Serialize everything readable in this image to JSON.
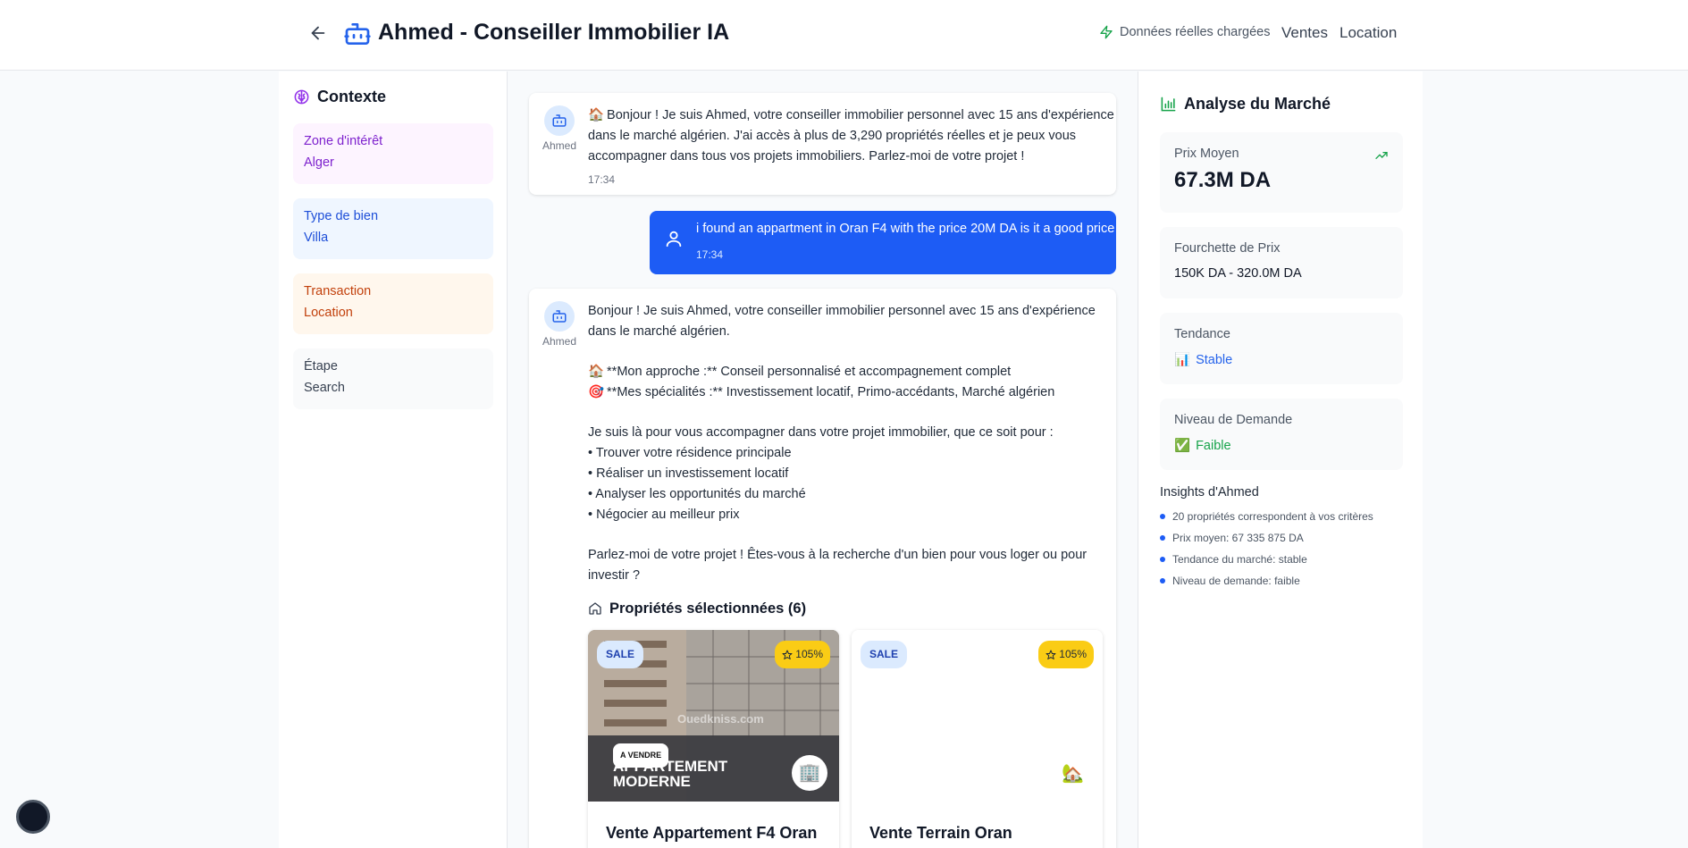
{
  "header": {
    "title": "Ahmed - Conseiller Immobilier IA",
    "status": "Données réelles chargées",
    "nav": [
      "Ventes",
      "Location"
    ]
  },
  "context": {
    "title": "Contexte",
    "cards": [
      {
        "label": "Zone d'intérêt",
        "value": "Alger",
        "bg": "#fdf4ff",
        "color": "#7e22ce"
      },
      {
        "label": "Type de bien",
        "value": "Villa",
        "bg": "#eff6ff",
        "color": "#1d4ed8"
      },
      {
        "label": "Transaction",
        "value": "Location",
        "bg": "#fff7ed",
        "color": "#c2410c"
      },
      {
        "label": "Étape",
        "value": "Search",
        "bg": "#f9fafb",
        "color": "#374151"
      }
    ]
  },
  "chat": {
    "bot_name": "Ahmed",
    "msg1": {
      "emoji": "🏠",
      "text_l1": "Bonjour ! Je suis Ahmed, votre conseiller immobilier personnel avec 15 ans d'expérience",
      "text_l2": "dans le marché algérien. J'ai accès à plus de 3,290 propriétés réelles et je peux vous",
      "text_l3": "accompagner dans tous vos projets immobiliers. Parlez-moi de votre projet !",
      "time": "17:34"
    },
    "user_msg": {
      "text": "i found an appartment in Oran F4 with the price 20M DA is it a good price",
      "time": "17:34"
    },
    "msg2": {
      "l1": "Bonjour ! Je suis Ahmed, votre conseiller immobilier personnel avec 15 ans d'expérience",
      "l2": "dans le marché algérien.",
      "approach_emoji": "🏠",
      "approach": "**Mon approche :** Conseil personnalisé et accompagnement complet",
      "spec_emoji": "🎯",
      "specialties": "**Mes spécialités :** Investissement locatif, Primo-accédants, Marché algérien",
      "intro": "Je suis là pour vous accompagner dans votre projet immobilier, que ce soit pour :",
      "bullets": [
        "• Trouver votre résidence principale",
        "• Réaliser un investissement locatif",
        "• Analyser les opportunités du marché",
        "• Négocier au meilleur prix"
      ],
      "cta_l1": "Parlez-moi de votre projet ! Êtes-vous à la recherche d'un bien pour vous loger ou pour",
      "cta_l2": "investir ?"
    },
    "properties": {
      "heading": "Propriétés sélectionnées (6)",
      "items": [
        {
          "badge": "SALE",
          "score": "105%",
          "title": "Vente Appartement F4 Oran",
          "img_tag": "A VENDRE",
          "img_l1": "APPARTEMENT",
          "img_l2": "MODERNE",
          "watermark": "Ouedkniss.com",
          "img_icon": "🏢"
        },
        {
          "badge": "SALE",
          "score": "105%",
          "title": "Vente Terrain Oran",
          "img_icon": "🏡"
        }
      ]
    }
  },
  "market": {
    "title": "Analyse du Marché",
    "avg_price_label": "Prix Moyen",
    "avg_price": "67.3M DA",
    "range_label": "Fourchette de Prix",
    "range": "150K DA - 320.0M DA",
    "trend_label": "Tendance",
    "trend_emoji": "📊",
    "trend": "Stable",
    "demand_label": "Niveau de Demande",
    "demand_emoji": "✅",
    "demand": "Faible",
    "insights_title": "Insights d'Ahmed",
    "insights": [
      "20 propriétés correspondent à vos critères",
      "Prix moyen: 67 335 875 DA",
      "Tendance du marché: stable",
      "Niveau de demande: faible"
    ]
  },
  "colors": {
    "primary": "#1d5cf5",
    "success": "#16a34a",
    "brand_icon": "#2563eb",
    "brain_icon": "#9333ea"
  }
}
